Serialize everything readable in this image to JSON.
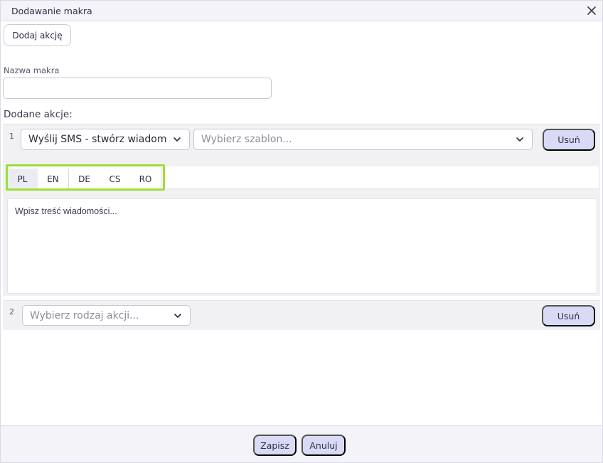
{
  "dialog": {
    "title": "Dodawanie makra"
  },
  "toolbar": {
    "add_action_label": "Dodaj akcję"
  },
  "macro_name": {
    "label": "Nazwa makra",
    "value": "",
    "placeholder": ""
  },
  "actions_section": {
    "label": "Dodane akcje:"
  },
  "actions": [
    {
      "index": "1",
      "type_value": "Wyślij SMS - stwórz wiadomość",
      "template_placeholder": "Wybierz szablon...",
      "remove_label": "Usuń",
      "tabs": [
        "PL",
        "EN",
        "DE",
        "CS",
        "RO"
      ],
      "active_tab": "PL",
      "message_placeholder": "Wpisz treść wiadomości..."
    },
    {
      "index": "2",
      "type_placeholder": "Wybierz rodzaj akcji...",
      "remove_label": "Usuń"
    }
  ],
  "footer": {
    "save_label": "Zapisz",
    "cancel_label": "Anuluj"
  },
  "colors": {
    "accent_button": "#d9dbf6",
    "highlight": "#9be032",
    "panel_bg": "#f1f1f4"
  },
  "icons": {
    "close": "close-icon",
    "dropdown": "chevron-down-icon"
  }
}
